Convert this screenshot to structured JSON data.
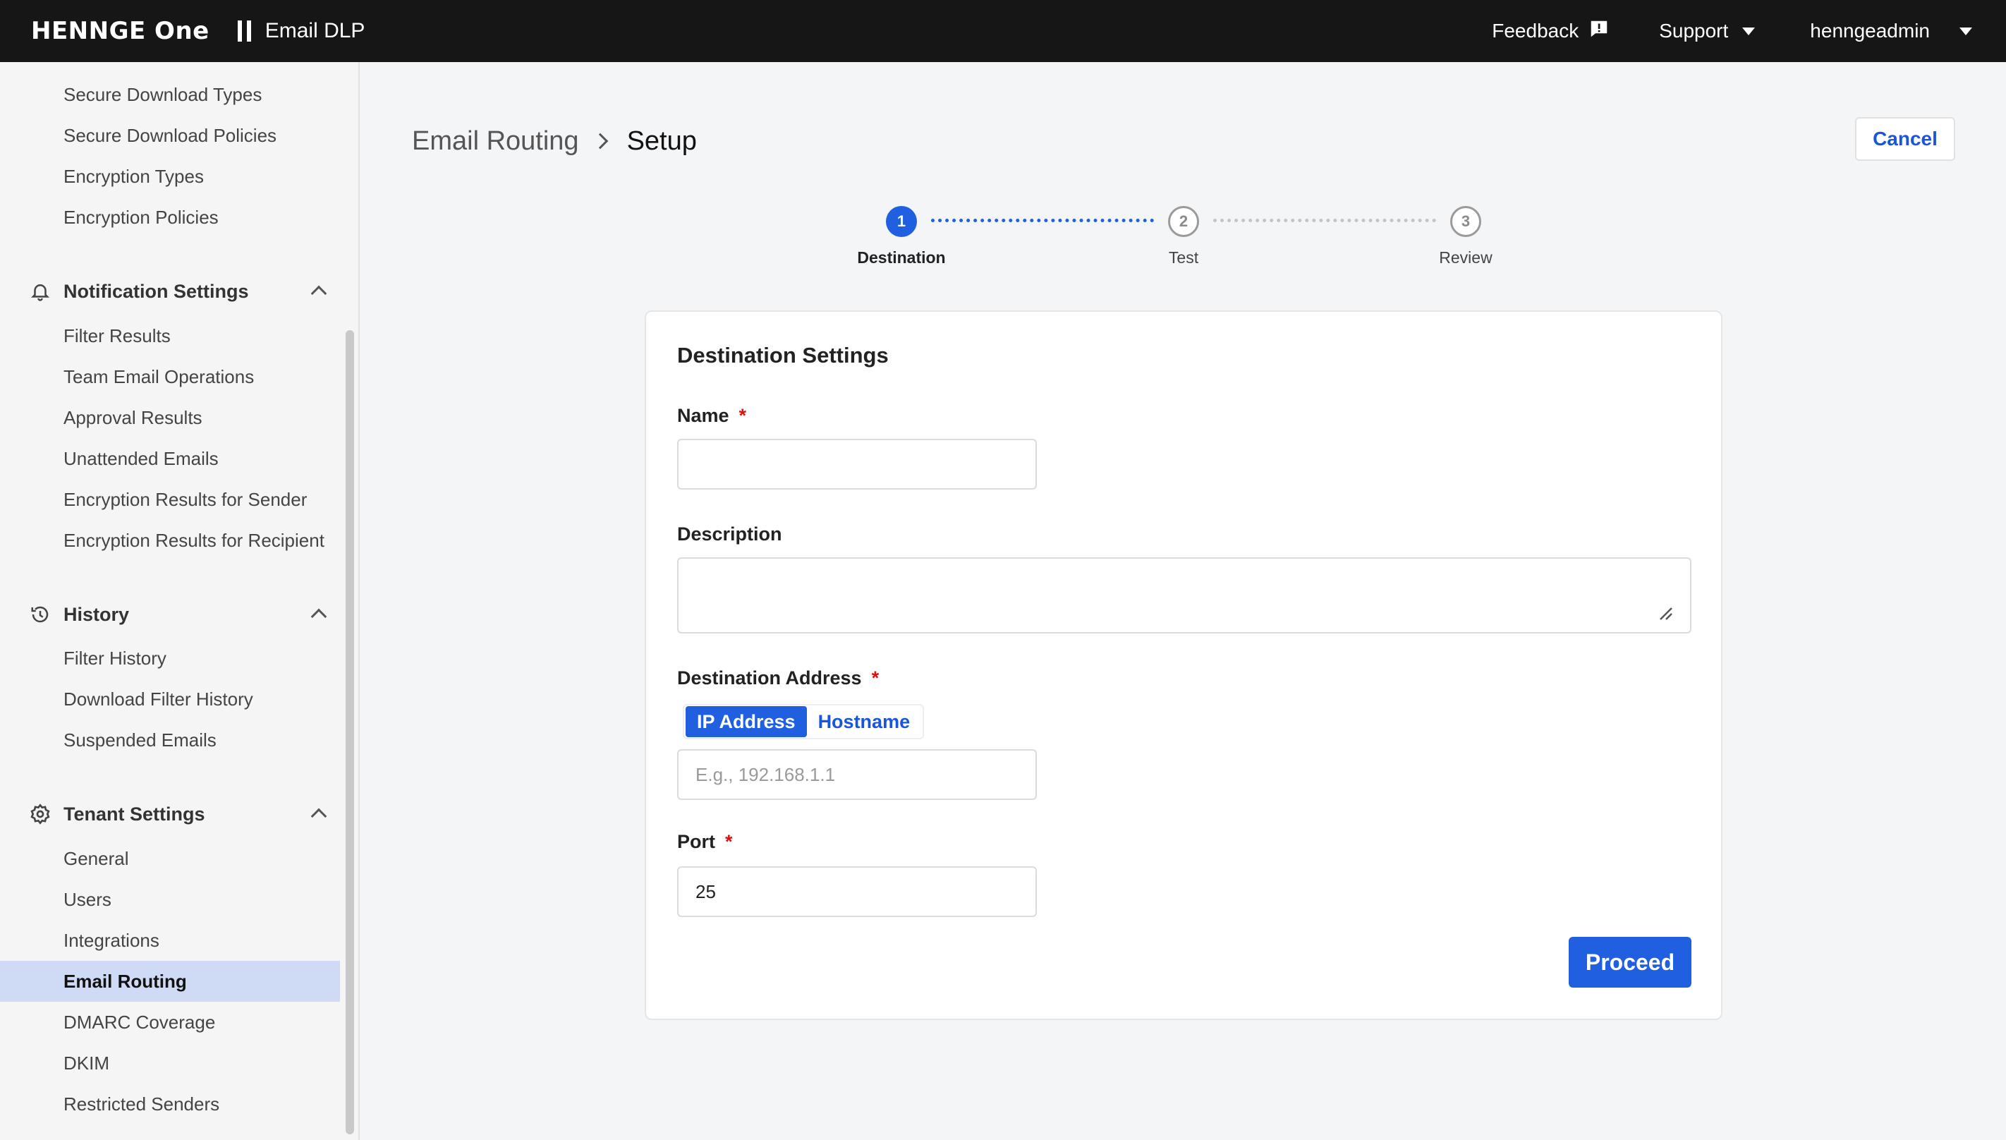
{
  "header": {
    "brand": "HENNGE One",
    "product": "Email DLP",
    "feedback": "Feedback",
    "support": "Support",
    "user": "henngeadmin"
  },
  "sidebar": {
    "items_top": [
      "Secure Download Types",
      "Secure Download Policies",
      "Encryption Types",
      "Encryption Policies"
    ],
    "notification": {
      "title": "Notification Settings",
      "items": [
        "Filter Results",
        "Team Email Operations",
        "Approval Results",
        "Unattended Emails",
        "Encryption Results for Sender",
        "Encryption Results for Recipient"
      ]
    },
    "history": {
      "title": "History",
      "items": [
        "Filter History",
        "Download Filter History",
        "Suspended Emails"
      ]
    },
    "tenant": {
      "title": "Tenant Settings",
      "items": [
        "General",
        "Users",
        "Integrations",
        "Email Routing",
        "DMARC Coverage",
        "DKIM",
        "Restricted Senders"
      ]
    },
    "active_item": "Email Routing"
  },
  "breadcrumb": {
    "parent": "Email Routing",
    "current": "Setup"
  },
  "cancel_label": "Cancel",
  "stepper": {
    "steps": [
      {
        "number": "1",
        "label": "Destination",
        "state": "active"
      },
      {
        "number": "2",
        "label": "Test",
        "state": "pending"
      },
      {
        "number": "3",
        "label": "Review",
        "state": "pending"
      }
    ]
  },
  "form": {
    "section_title": "Destination Settings",
    "name_label": "Name",
    "name_value": "",
    "description_label": "Description",
    "description_value": "",
    "destination_label": "Destination Address",
    "toggle_ip": "IP Address",
    "toggle_hostname": "Hostname",
    "address_placeholder": "E.g., 192.168.1.1",
    "port_label": "Port",
    "port_value": "25",
    "required_mark": "*",
    "proceed_label": "Proceed"
  },
  "colors": {
    "accent": "#1f5fe0",
    "topbar": "#161616",
    "active_nav": "#cfdaf5",
    "required": "#dd1111"
  }
}
